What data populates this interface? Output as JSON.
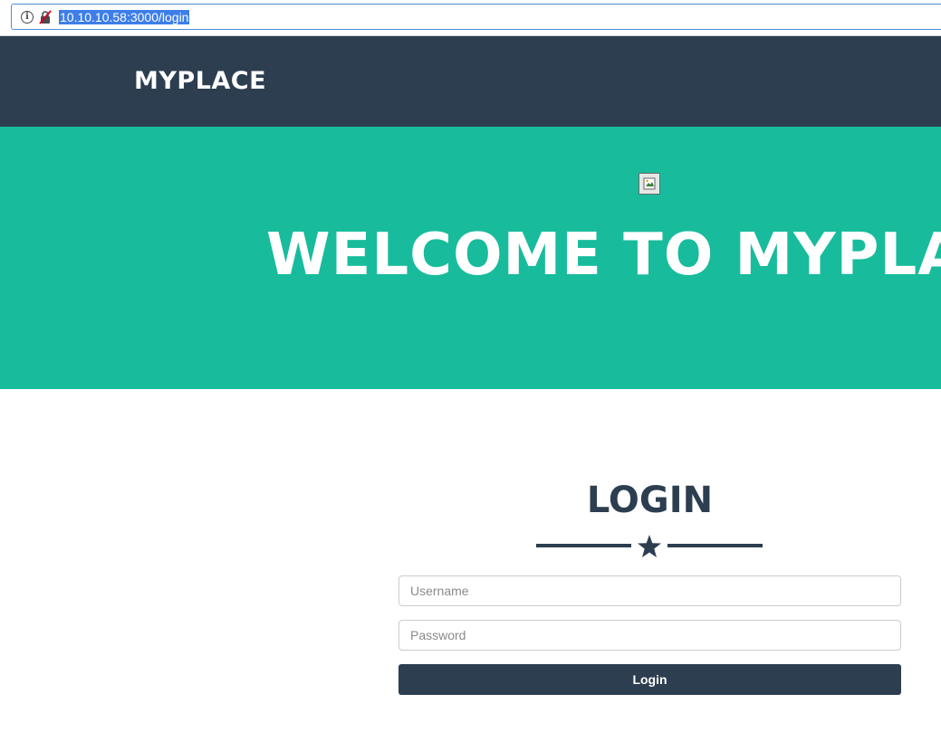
{
  "browser": {
    "url": "10.10.10.58:3000/login"
  },
  "navbar": {
    "brand": "MYPLACE"
  },
  "hero": {
    "title": "WELCOME TO MYPLA",
    "image_icon": "broken-image-icon"
  },
  "login": {
    "title": "LOGIN",
    "divider_icon": "star-icon",
    "username_placeholder": "Username",
    "password_placeholder": "Password",
    "button_label": "Login"
  },
  "colors": {
    "navbar": "#2c3e50",
    "hero": "#18bc9c",
    "button": "#2c3e50"
  }
}
